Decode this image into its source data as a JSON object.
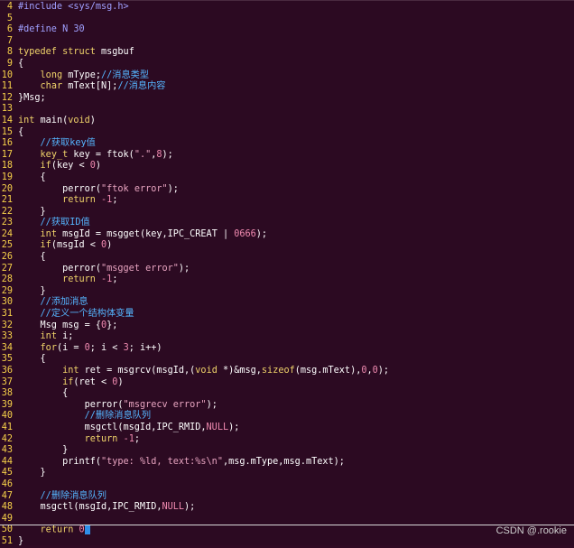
{
  "editor": {
    "lines": [
      {
        "n": "4",
        "t": "#include <sys/msg.h>"
      },
      {
        "n": "5",
        "t": ""
      },
      {
        "n": "6",
        "t": "#define N 30"
      },
      {
        "n": "7",
        "t": ""
      },
      {
        "n": "8",
        "t": "typedef struct msgbuf"
      },
      {
        "n": "9",
        "t": "{"
      },
      {
        "n": "10",
        "t": "    long mType;//消息类型"
      },
      {
        "n": "11",
        "t": "    char mText[N];//消息内容"
      },
      {
        "n": "12",
        "t": "}Msg;"
      },
      {
        "n": "13",
        "t": ""
      },
      {
        "n": "14",
        "t": "int main(void)"
      },
      {
        "n": "15",
        "t": "{"
      },
      {
        "n": "16",
        "t": "    //获取key值"
      },
      {
        "n": "17",
        "t": "    key_t key = ftok(\".\",8);"
      },
      {
        "n": "18",
        "t": "    if(key < 0)"
      },
      {
        "n": "19",
        "t": "    {"
      },
      {
        "n": "20",
        "t": "        perror(\"ftok error\");"
      },
      {
        "n": "21",
        "t": "        return -1;"
      },
      {
        "n": "22",
        "t": "    }"
      },
      {
        "n": "23",
        "t": "    //获取ID值"
      },
      {
        "n": "24",
        "t": "    int msgId = msgget(key,IPC_CREAT | 0666);"
      },
      {
        "n": "25",
        "t": "    if(msgId < 0)"
      },
      {
        "n": "26",
        "t": "    {"
      },
      {
        "n": "27",
        "t": "        perror(\"msgget error\");"
      },
      {
        "n": "28",
        "t": "        return -1;"
      },
      {
        "n": "29",
        "t": "    }"
      },
      {
        "n": "30",
        "t": "    //添加消息"
      },
      {
        "n": "31",
        "t": "    //定义一个结构体变量"
      },
      {
        "n": "32",
        "t": "    Msg msg = {0};"
      },
      {
        "n": "33",
        "t": "    int i;"
      },
      {
        "n": "34",
        "t": "    for(i = 0; i < 3; i++)"
      },
      {
        "n": "35",
        "t": "    {"
      },
      {
        "n": "36",
        "t": "        int ret = msgrcv(msgId,(void *)&msg,sizeof(msg.mText),0,0);"
      },
      {
        "n": "37",
        "t": "        if(ret < 0)"
      },
      {
        "n": "38",
        "t": "        {"
      },
      {
        "n": "39",
        "t": "            perror(\"msgrecv error\");"
      },
      {
        "n": "40",
        "t": "            //删除消息队列"
      },
      {
        "n": "41",
        "t": "            msgctl(msgId,IPC_RMID,NULL);"
      },
      {
        "n": "42",
        "t": "            return -1;"
      },
      {
        "n": "43",
        "t": "        }"
      },
      {
        "n": "44",
        "t": "        printf(\"type: %ld, text:%s\\n\",msg.mType,msg.mText);"
      },
      {
        "n": "45",
        "t": "    }"
      },
      {
        "n": "46",
        "t": ""
      },
      {
        "n": "47",
        "t": "    //删除消息队列"
      },
      {
        "n": "48",
        "t": "    msgctl(msgId,IPC_RMID,NULL);"
      },
      {
        "n": "49",
        "t": ""
      },
      {
        "n": "50",
        "t": "    return 0;"
      },
      {
        "n": "51",
        "t": "}"
      }
    ],
    "cursor_line": "50"
  },
  "colors": {
    "background": "#2c0a22",
    "line_numbers": "#f8d24a",
    "keyword": "#f0d36a",
    "preprocessor": "#a0a0ff",
    "string": "#e8a4c0",
    "number": "#f08ab0",
    "comment": "#55b5ff",
    "cursor": "#2f8fe8"
  },
  "watermark": {
    "text": "CSDN @.rookie"
  }
}
